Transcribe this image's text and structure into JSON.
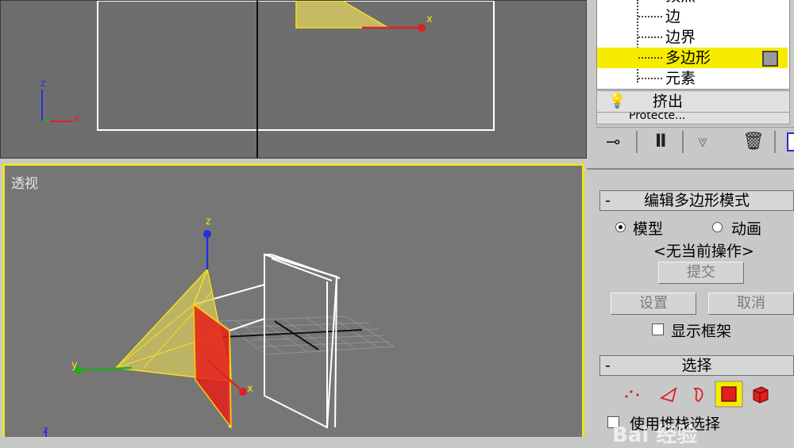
{
  "viewport_top": {},
  "viewport_persp": {
    "label": "透视"
  },
  "axes": {
    "x": "x",
    "y": "y",
    "z": "z"
  },
  "modifier_stack": {
    "items": [
      {
        "label": "顶点"
      },
      {
        "label": "边"
      },
      {
        "label": "边界"
      },
      {
        "label": "多边形",
        "selected": true
      },
      {
        "label": "元素"
      }
    ],
    "extrude": "挤出",
    "next_partial": "Protecte..."
  },
  "edit_poly_mode": {
    "title": "编辑多边形模式",
    "collapse": "-",
    "radio_model": "模型",
    "radio_animate": "动画",
    "status": "<无当前操作>",
    "commit": "提交",
    "settings": "设置",
    "cancel": "取消",
    "show_cage": "显示框架"
  },
  "selection": {
    "title": "选择",
    "collapse": "-",
    "by_vertex": "使用堆栈选择"
  },
  "colors": {
    "highlight": "#f5ec00",
    "viewport_active_border": "#f2e21b",
    "polygon_fill": "#e8201a"
  },
  "watermark": "Bai 经验"
}
